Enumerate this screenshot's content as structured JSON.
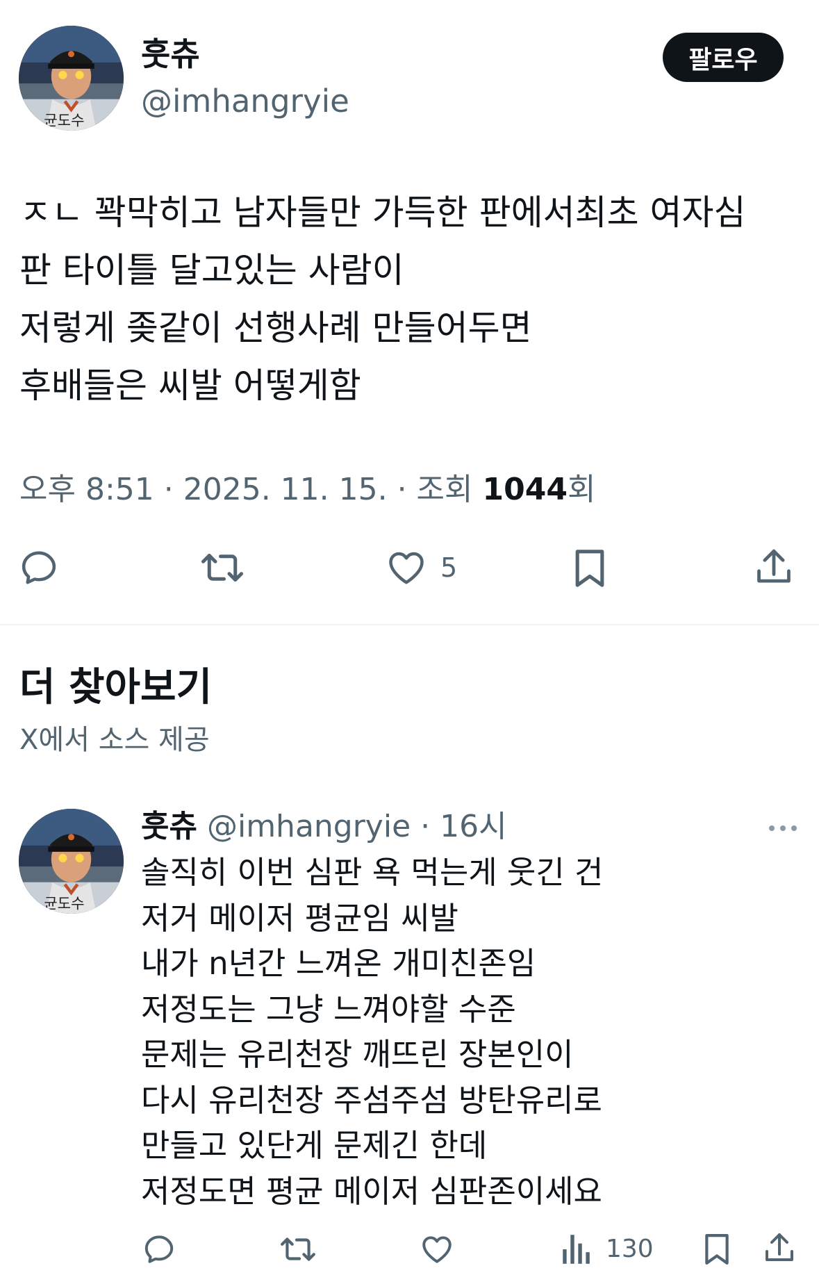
{
  "main_tweet": {
    "author_name": "훗츄",
    "author_handle": "@imhangryie",
    "follow_label": "팔로우",
    "text_lines": [
      "ㅈㄴ 꽉막히고 남자들만 가득한 판에서최초 여자심",
      "판 타이틀 달고있는 사람이",
      "저렇게 좆같이 선행사례 만들어두면",
      "후배들은 씨발 어떻게함"
    ],
    "meta_prefix": "오후 8:51 · 2025. 11. 15. · 조회 ",
    "views": "1044",
    "views_suffix": "회",
    "likes": "5",
    "icons": [
      "reply-icon",
      "retweet-icon",
      "heart-icon",
      "bookmark-icon",
      "share-icon"
    ]
  },
  "discover": {
    "title": "더 찾아보기",
    "subtitle": "X에서 소스 제공"
  },
  "related_tweet": {
    "author_name": "훗츄",
    "author_handle": "@imhangryie",
    "separator": " · ",
    "time": "16시",
    "text_lines": [
      "솔직히 이번 심판 욕 먹는게 웃긴 건",
      "저거 메이저 평균임 씨발",
      "내가 n년간 느껴온 개미친존임",
      "저정도는 그냥 느껴야할 수준",
      "문제는 유리천장 깨뜨린 장본인이",
      "다시 유리천장 주섬주섬 방탄유리로",
      "만들고 있단게 문제긴 한데",
      "저정도면 평균 메이저 심판존이세요"
    ],
    "views": "130",
    "icons": [
      "reply-icon",
      "retweet-icon",
      "heart-icon",
      "views-icon",
      "bookmark-icon",
      "share-icon",
      "more-icon"
    ]
  },
  "colors": {
    "text": "#0f1419",
    "secondary": "#536471",
    "follow_bg": "#0f1419",
    "divider": "#eff3f4"
  }
}
